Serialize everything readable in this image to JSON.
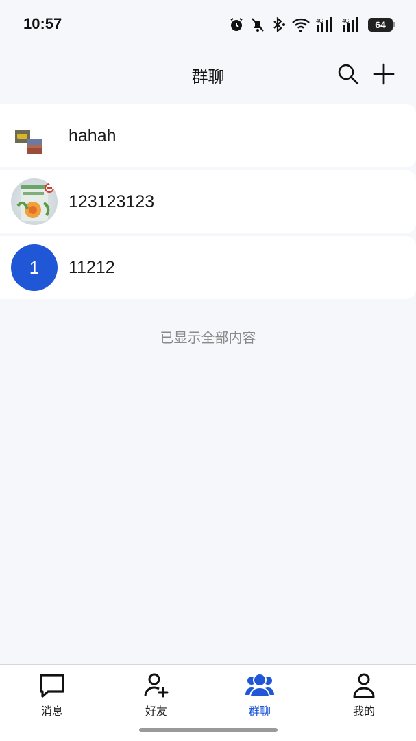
{
  "status_bar": {
    "time": "10:57",
    "battery": "64",
    "icons": [
      "alarm-icon",
      "mute-icon",
      "bluetooth-icon",
      "wifi-icon",
      "signal-4g-icon",
      "signal-4g-icon",
      "battery-icon"
    ]
  },
  "header": {
    "title": "群聊",
    "search_icon": "search-icon",
    "add_icon": "plus-icon"
  },
  "groups": [
    {
      "name": "hahah",
      "avatar": "photo"
    },
    {
      "name": "123123123",
      "avatar": "photo"
    },
    {
      "name": "11212",
      "avatar": "letter",
      "avatar_text": "1",
      "avatar_color": "#1f57d6"
    }
  ],
  "list_end_note": "已显示全部内容",
  "tabs": [
    {
      "label": "消息",
      "icon": "chat-bubble-icon",
      "active": false
    },
    {
      "label": "好友",
      "icon": "add-friend-icon",
      "active": false
    },
    {
      "label": "群聊",
      "icon": "group-icon",
      "active": true
    },
    {
      "label": "我的",
      "icon": "profile-icon",
      "active": false
    }
  ],
  "colors": {
    "accent": "#1f57d6",
    "background": "#f6f7fb"
  }
}
